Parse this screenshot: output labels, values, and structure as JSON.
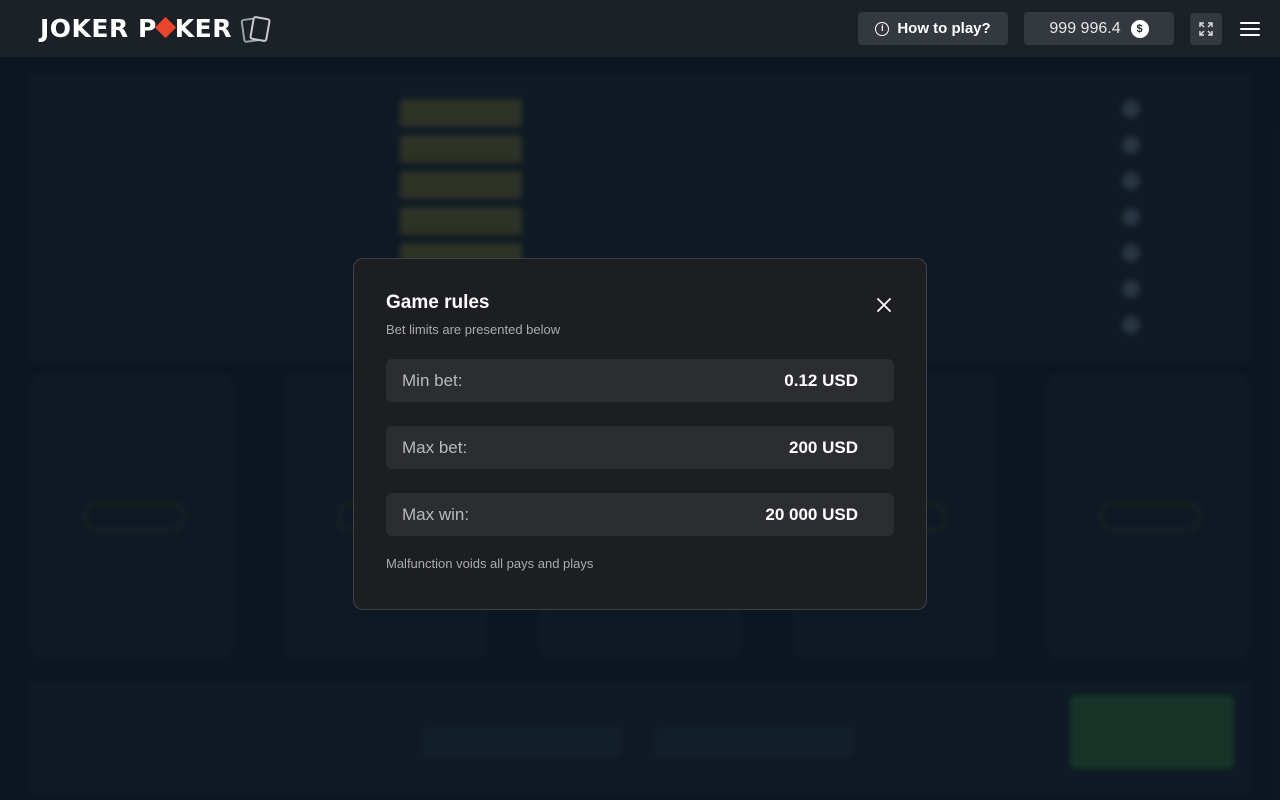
{
  "header": {
    "logo_left": "JOKER P",
    "logo_right": "KER",
    "how_to_play": "How to play?",
    "balance": "999 996.4",
    "currency_symbol": "$"
  },
  "modal": {
    "title": "Game rules",
    "subtitle": "Bet limits are presented below",
    "limits": [
      {
        "label": "Min bet:",
        "value": "0.12 USD"
      },
      {
        "label": "Max bet:",
        "value": "200 USD"
      },
      {
        "label": "Max win:",
        "value": "20 000 USD"
      }
    ],
    "footnote": "Malfunction voids all pays and plays"
  },
  "colors": {
    "header_bg": "#1c2027",
    "modal_bg": "#1d1e22",
    "row_bg": "#2c2d31",
    "logo_accent": "#e8452c",
    "page_bg": "#0d1620"
  }
}
